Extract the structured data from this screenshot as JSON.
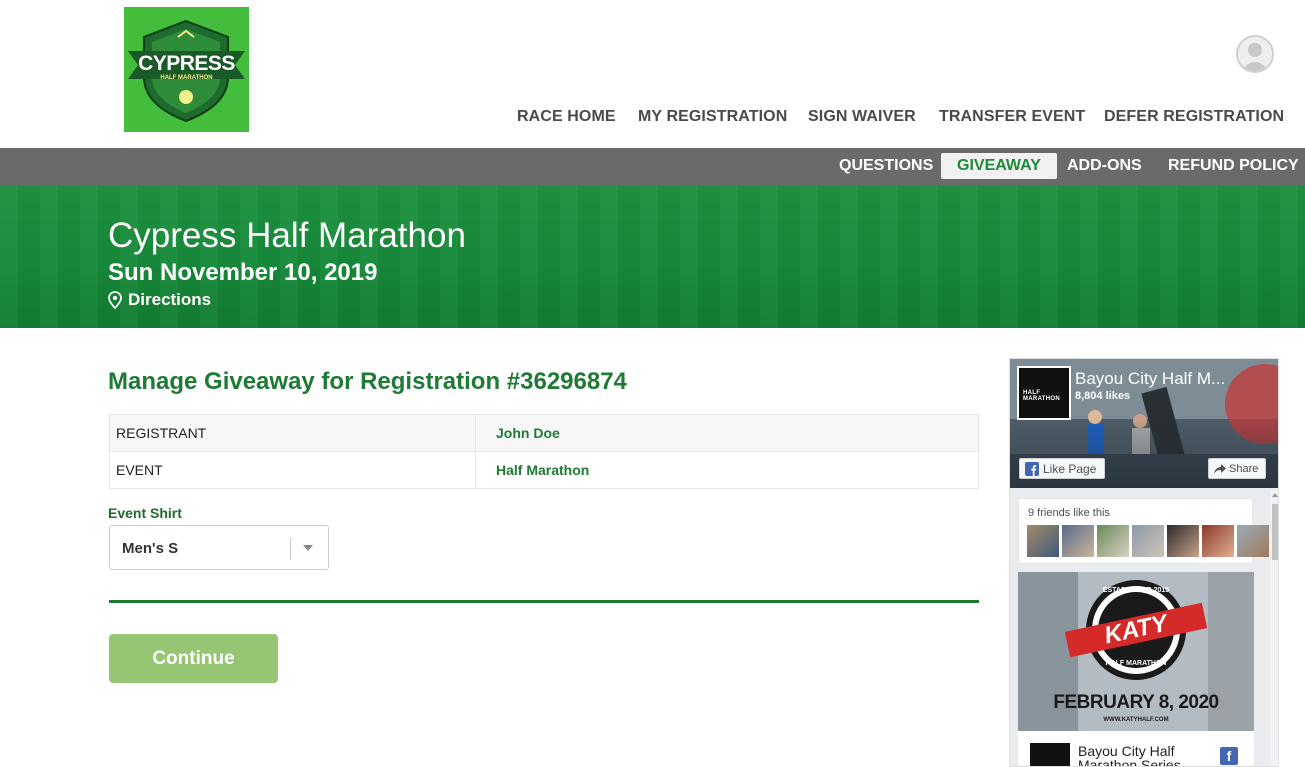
{
  "header": {
    "logo_title": "CYPRESS",
    "logo_subtitle": "HALF MARATHON",
    "nav": [
      {
        "label": "RACE HOME"
      },
      {
        "label": "MY REGISTRATION"
      },
      {
        "label": "SIGN WAIVER"
      },
      {
        "label": "TRANSFER EVENT"
      },
      {
        "label": "DEFER REGISTRATION"
      }
    ]
  },
  "subnav": [
    {
      "label": "QUESTIONS",
      "active": false
    },
    {
      "label": "GIVEAWAY",
      "active": true
    },
    {
      "label": "ADD-ONS",
      "active": false
    },
    {
      "label": "REFUND POLICY",
      "active": false
    }
  ],
  "hero": {
    "title": "Cypress Half Marathon",
    "date": "Sun November 10, 2019",
    "directions": "Directions"
  },
  "main": {
    "title": "Manage Giveaway for Registration #36296874",
    "rows": [
      {
        "key": "REGISTRANT",
        "value": "John Doe"
      },
      {
        "key": "EVENT",
        "value": "Half Marathon"
      }
    ],
    "shirt_label": "Event Shirt",
    "shirt_value": "Men's S",
    "continue_label": "Continue"
  },
  "facebook": {
    "page_name": "Bayou City Half M...",
    "likes": "8,804 likes",
    "like_label": "Like Page",
    "share_label": "Share",
    "friends_text": "9 friends like this",
    "post_name": "Bayou City Half Marathon Series",
    "post_image_text": "FEBRUARY 8, 2020",
    "post_image_brand": "KATY",
    "post_image_top": "ESTABLISHED 2015",
    "post_image_bottom": "HALF MARATHON",
    "post_image_url": "WWW.KATYHALF.COM",
    "profile_text": "HALF MARATHON"
  },
  "colors": {
    "brand_green": "#1f7a36",
    "hero_green": "#178a3a",
    "subnav_gray": "#6a6a6a",
    "continue_disabled": "#96c673",
    "facebook_blue": "#4267b2"
  }
}
